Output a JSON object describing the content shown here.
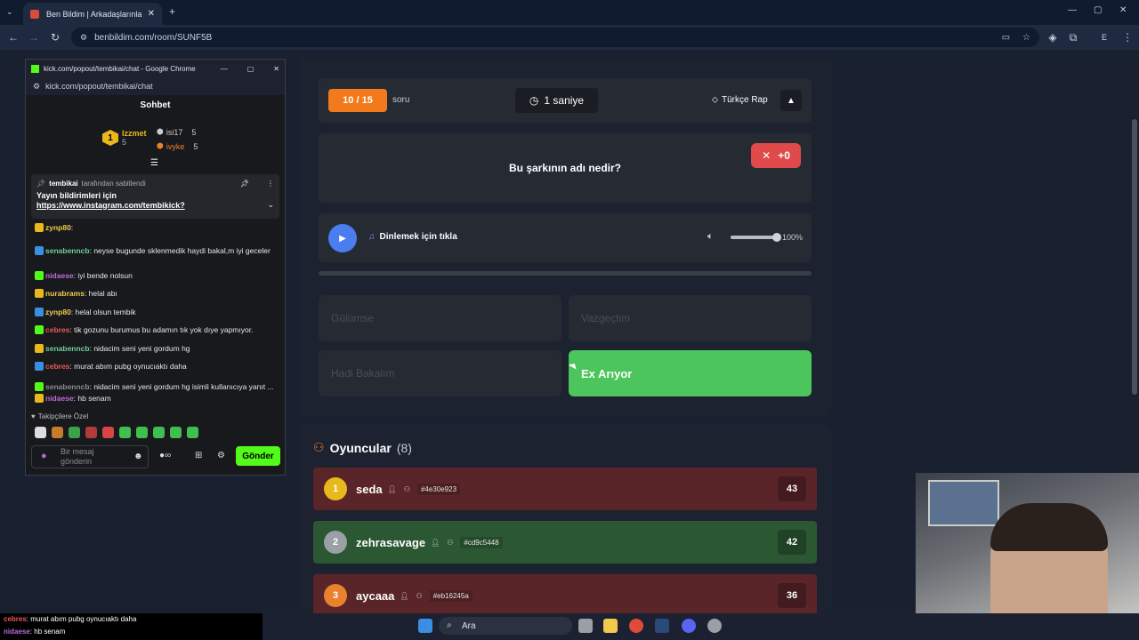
{
  "browser": {
    "tab_title": "Ben Bildim | Arkadaşlarınla Onli",
    "url": "benbildim.com/room/SUNF5B"
  },
  "chat_window": {
    "title": "kick.com/popout/tembikai/chat - Google Chrome",
    "url": "kick.com/popout/tembikai/chat",
    "header": "Sohbet",
    "top_users": [
      {
        "rank": "1",
        "name": "Izzmet",
        "count": "5"
      },
      {
        "rank": "2",
        "name": "isi17",
        "count": "5"
      },
      {
        "rank": "3",
        "name": "ivyke",
        "count": "5"
      }
    ],
    "pinned": {
      "author": "tembikai",
      "label": "tarafından sabitlendi",
      "text": "Yayın bildirimleri için",
      "link": "https://www.instagram.com/tembikick?"
    },
    "messages": [
      {
        "user": "zynp80",
        "text": ":",
        "color": "#f2c94c"
      },
      {
        "user": "senabenncb",
        "text": ": neyse bugunde sklenmedik haydi bakal,m iyi geceler",
        "color": "#6fcf97"
      },
      {
        "user": "nidaese",
        "text": ": iyi bende nolsun",
        "color": "#bb6bd9"
      },
      {
        "user": "nurabrams",
        "text": ": helal abı",
        "color": "#f2c94c"
      },
      {
        "user": "zynp80",
        "text": ": helal olsun tembik",
        "color": "#f2c94c"
      },
      {
        "user": "cebres",
        "text": ": tik gozunu burumus bu adamın tık yok dıye yapmıyor.",
        "color": "#eb5757"
      },
      {
        "user": "senabenncb",
        "text": ": nidacim seni yeni gordum hg",
        "color": "#6fcf97"
      },
      {
        "user": "cebres",
        "text": ": murat abım pubg oynucıaktı daha",
        "color": "#eb5757"
      },
      {
        "user": "senabenncb",
        "text": ": nidacim seni yeni gordum hg isimli kullanıcıya yanıt ...",
        "color": "#8a8d94"
      },
      {
        "user": "nidaese",
        "text": ": hb senam",
        "color": "#bb6bd9"
      }
    ],
    "followers_label": "Takipçilere Özel",
    "input_placeholder": "Bir mesaj gönderin",
    "send_label": "Gönder"
  },
  "game": {
    "progress": "10 / 15",
    "soru_label": "soru",
    "timer": "1 saniye",
    "category": "Türkçe Rap",
    "question": "Bu şarkının adı nedir?",
    "score_delta": "+0",
    "listen_label": "Dinlemek için tıkla",
    "volume": "100%",
    "volume_fraction": 1.0,
    "answers": [
      "Gülümse",
      "Vazgeçtim",
      "Hadi Bakalım",
      "Ex Arıyor"
    ]
  },
  "players": {
    "title": "Oyuncular",
    "count": "(8)",
    "list": [
      {
        "rank": "1",
        "name": "seda",
        "code": "#4e30e923",
        "score": "43",
        "row_color": "#5a2529",
        "rank_color": "#e9b81c"
      },
      {
        "rank": "2",
        "name": "zehrasavage",
        "code": "#cd9c5448",
        "score": "42",
        "row_color": "#2b5733",
        "rank_color": "#9aa0a6"
      },
      {
        "rank": "3",
        "name": "aycaaa",
        "code": "#eb16245a",
        "score": "36",
        "row_color": "#5a2529",
        "rank_color": "#e8822c"
      }
    ]
  },
  "taskbar": {
    "search_label": "Ara"
  },
  "ticker": [
    {
      "user": "cebres",
      "text": ": murat abım pubg oynucıaktı daha"
    },
    {
      "user": "nidaese",
      "text": ": hb senam"
    }
  ]
}
